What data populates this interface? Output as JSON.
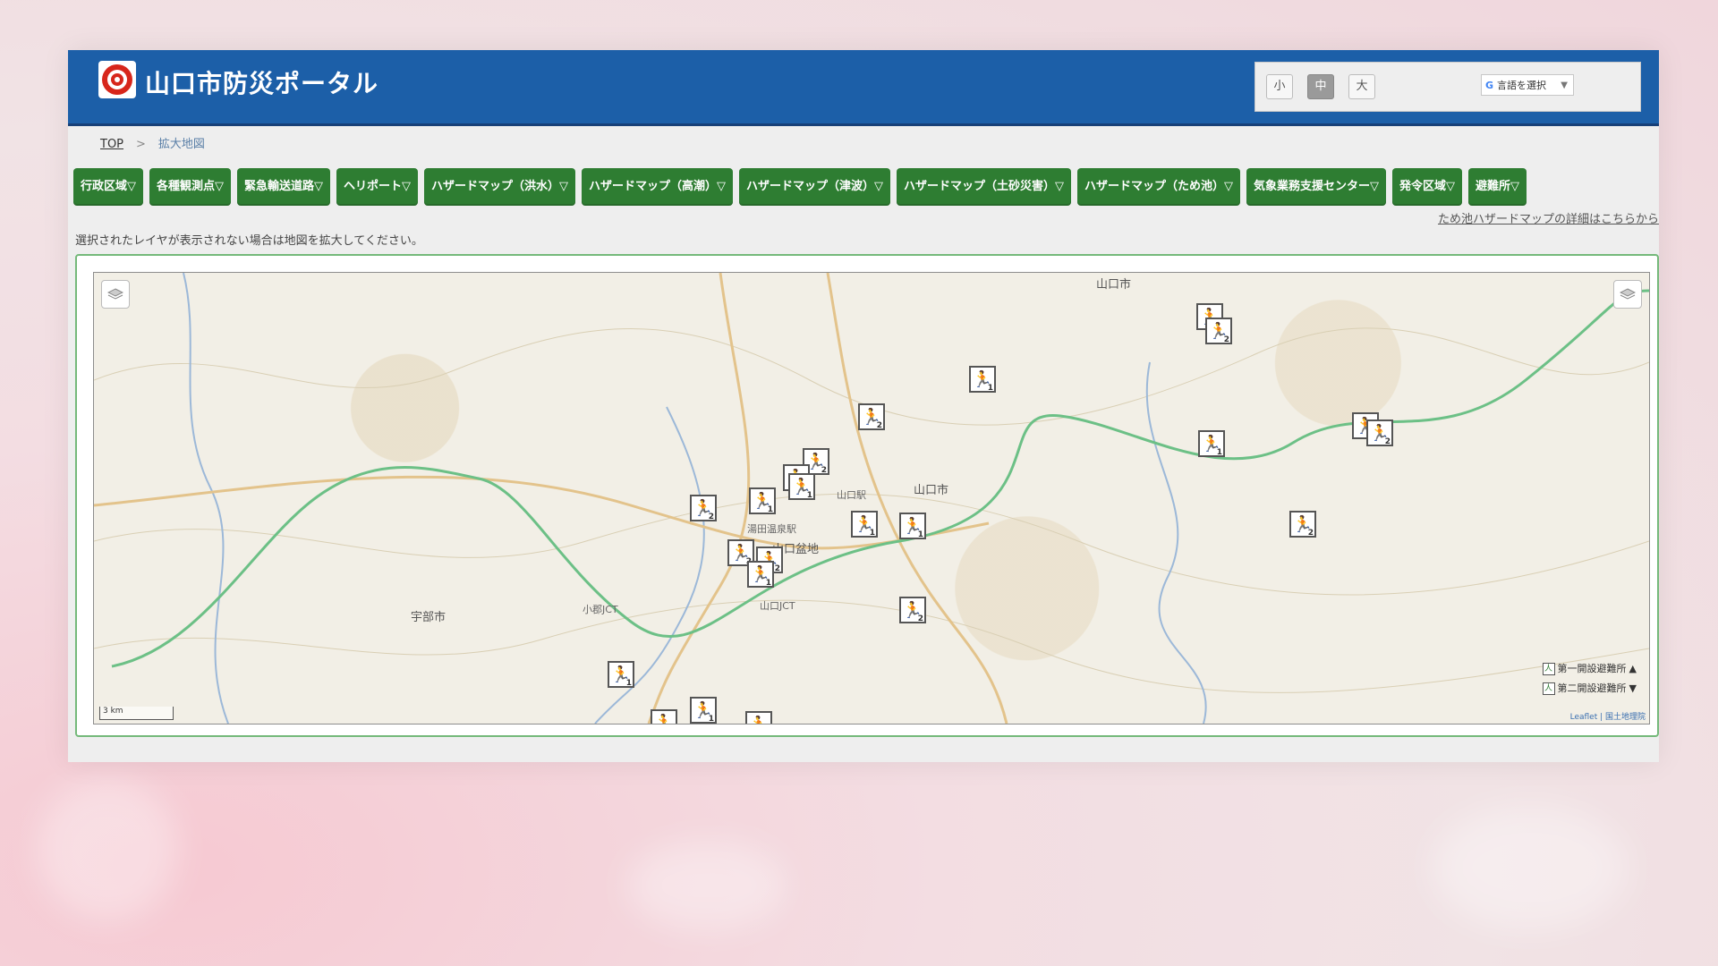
{
  "header": {
    "site_title": "山口市防災ポータル",
    "font_sizes": [
      "小",
      "中",
      "大"
    ],
    "active_font_size": "中",
    "language_label": "言語を選択"
  },
  "breadcrumb": {
    "top": "TOP",
    "separator": ">",
    "current": "拡大地図"
  },
  "nav": [
    "行政区域▽",
    "各種観測点▽",
    "緊急輸送道路▽",
    "ヘリポート▽",
    "ハザードマップ（洪水）▽",
    "ハザードマップ（高潮）▽",
    "ハザードマップ（津波）▽",
    "ハザードマップ（土砂災害）▽",
    "ハザードマップ（ため池）▽",
    "気象業務支援センター▽",
    "発令区域▽",
    "避難所▽"
  ],
  "tame_link": "ため池ハザードマップの詳細はこちらから",
  "notice": "選択されたレイヤが表示されない場合は地図を拡大してください。",
  "map": {
    "place_labels": [
      "山口市",
      "山口市",
      "山口盆地",
      "宇部市",
      "山口JCT",
      "小郡JCT",
      "湯田温泉駅",
      "山口駅"
    ],
    "shelter_numbers": [
      "1",
      "2",
      "1",
      "2",
      "1",
      "1",
      "2",
      "2",
      "1",
      "1",
      "2",
      "1",
      "1",
      "1",
      "2",
      "2",
      "2",
      "1",
      "2",
      "1",
      "1",
      "2",
      "2",
      "1",
      "1",
      "1"
    ],
    "legend": [
      "第一開設避難所",
      "第二開設避難所"
    ],
    "scale": "3 km",
    "attribution": "Leaflet | 国土地理院",
    "colors": {
      "expressway": "#6cc086",
      "road": "#e3c38b",
      "river": "#9cb8d8",
      "shelter_icon": "#2e7d32"
    }
  }
}
